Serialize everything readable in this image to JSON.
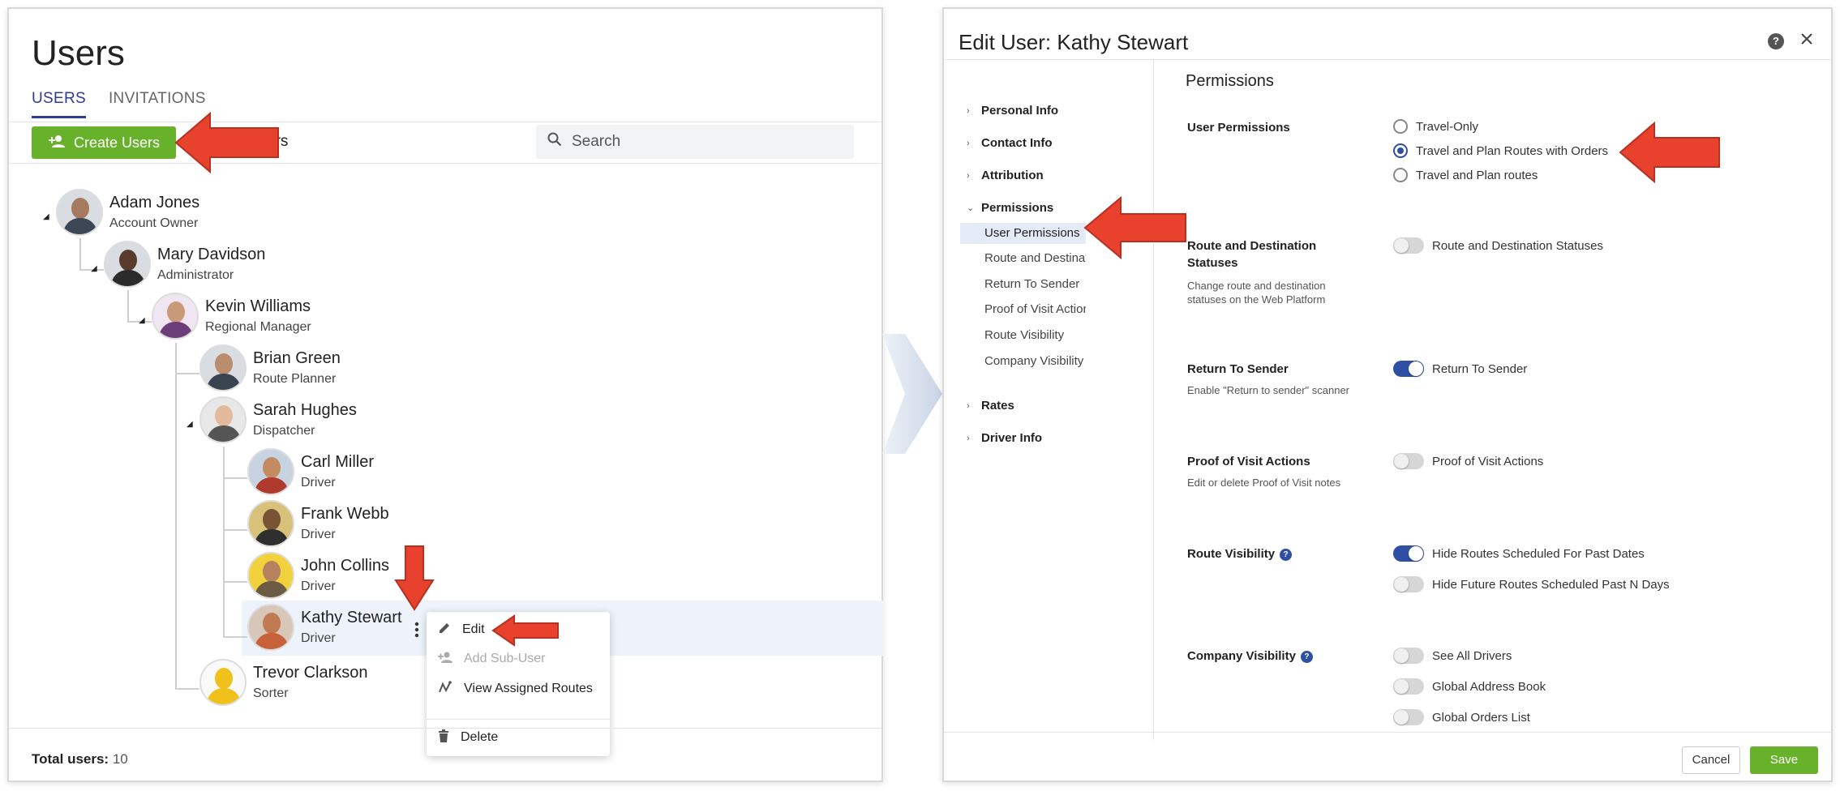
{
  "users_page": {
    "title": "Users",
    "tabs": [
      "USERS",
      "INVITATIONS"
    ],
    "create_button": "Create Users",
    "partial_toolbar_text": "ers",
    "search_placeholder": "Search",
    "tree": [
      {
        "name": "Adam Jones",
        "role": "Account Owner"
      },
      {
        "name": "Mary Davidson",
        "role": "Administrator"
      },
      {
        "name": "Kevin Williams",
        "role": "Regional Manager"
      },
      {
        "name": "Brian Green",
        "role": "Route Planner"
      },
      {
        "name": "Sarah Hughes",
        "role": "Dispatcher"
      },
      {
        "name": "Carl Miller",
        "role": "Driver"
      },
      {
        "name": "Frank Webb",
        "role": "Driver"
      },
      {
        "name": "John Collins",
        "role": "Driver"
      },
      {
        "name": "Kathy Stewart",
        "role": "Driver"
      },
      {
        "name": "Trevor Clarkson",
        "role": "Sorter"
      }
    ],
    "context_menu": [
      "Edit",
      "Add Sub-User",
      "View Assigned Routes",
      "Delete"
    ],
    "total_label": "Total users:",
    "total_value": "10"
  },
  "edit_dialog": {
    "title": "Edit User: Kathy Stewart",
    "help": "?",
    "nav": [
      "Personal Info",
      "Contact Info",
      "Attribution",
      "Permissions",
      "Rates",
      "Driver Info"
    ],
    "sub_nav": [
      "User Permissions",
      "Route and Destinatio...",
      "Return To Sender",
      "Proof of Visit Actions",
      "Route Visibility",
      "Company Visibility"
    ],
    "section_title": "Permissions",
    "user_permissions": {
      "label": "User Permissions",
      "options": [
        "Travel-Only",
        "Travel and Plan Routes with Orders",
        "Travel and Plan routes"
      ],
      "selected": "Travel and Plan Routes with Orders"
    },
    "route_destination": {
      "label": "Route and Destination Statuses",
      "desc": "Change route and destination statuses on the Web Platform",
      "toggle_label": "Route and Destination Statuses",
      "on": false
    },
    "return_to_sender": {
      "label": "Return To Sender",
      "desc": "Enable \"Return to sender\" scanner",
      "toggle_label": "Return To Sender",
      "on": true
    },
    "proof_of_visit": {
      "label": "Proof of Visit Actions",
      "desc": "Edit or delete Proof of Visit notes",
      "toggle_label": "Proof of Visit Actions",
      "on": false
    },
    "route_visibility": {
      "label": "Route Visibility",
      "toggles": [
        {
          "label": "Hide Routes Scheduled For Past Dates",
          "on": true
        },
        {
          "label": "Hide Future Routes Scheduled Past N Days",
          "on": false
        }
      ]
    },
    "company_visibility": {
      "label": "Company Visibility",
      "toggles": [
        {
          "label": "See All Drivers",
          "on": false
        },
        {
          "label": "Global Address Book",
          "on": false
        },
        {
          "label": "Global Orders List",
          "on": false
        }
      ]
    },
    "cancel": "Cancel",
    "save": "Save"
  },
  "colors": {
    "accent_green": "#68b22b",
    "accent_blue": "#2f4fa3",
    "annotation_red": "#e8422f"
  },
  "icons": [
    "add-user-icon",
    "search-icon",
    "pencil-icon",
    "add-user-icon",
    "routes-icon",
    "trash-icon",
    "kebab-icon",
    "help-icon",
    "close-icon",
    "chevron-right-icon",
    "chevron-down-icon",
    "red-arrow-icon"
  ]
}
